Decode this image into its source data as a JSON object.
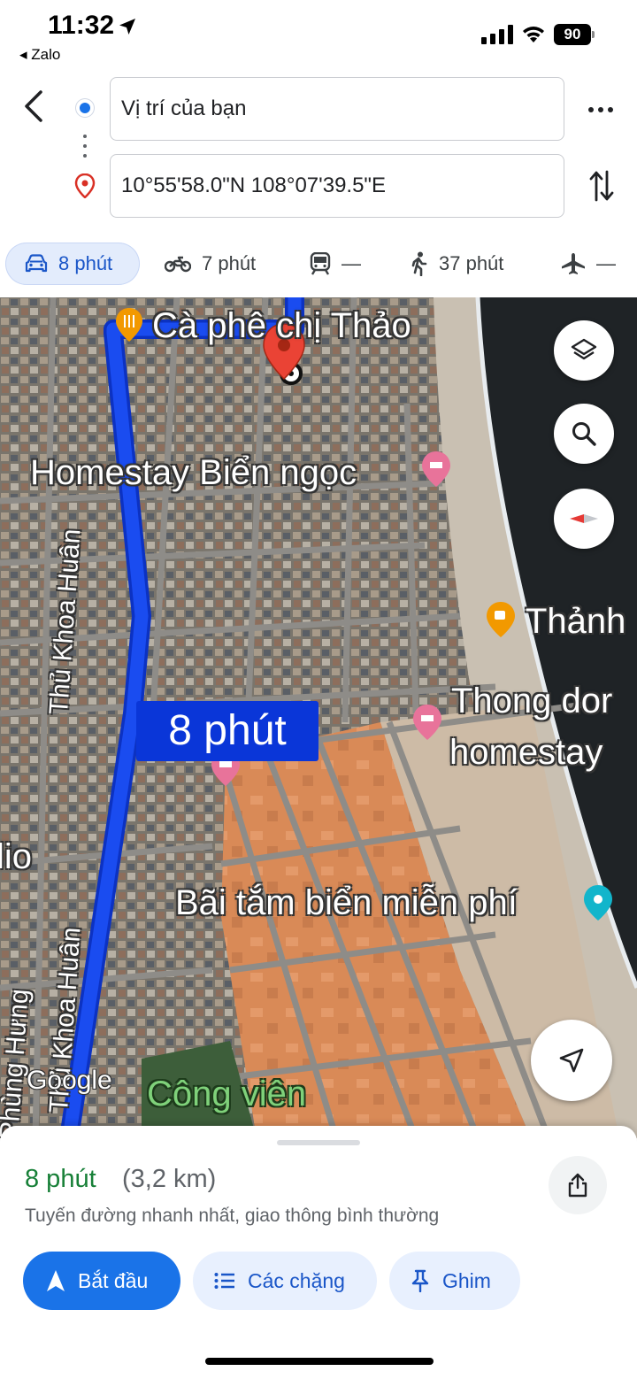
{
  "status_bar": {
    "time": "11:32",
    "back_app": "◂ Zalo",
    "battery": "90"
  },
  "route": {
    "origin": "Vị trí của bạn",
    "destination": "10°55'58.0\"N 108°07'39.5\"E"
  },
  "modes": [
    {
      "name": "drive",
      "label": "8 phút",
      "active": true
    },
    {
      "name": "motorbike",
      "label": "7 phút"
    },
    {
      "name": "transit",
      "label": "—"
    },
    {
      "name": "walk",
      "label": "37 phút"
    },
    {
      "name": "flight",
      "label": "—"
    }
  ],
  "map": {
    "labels": {
      "cafe": "Cà phê chị Thảo",
      "homestay_bien_ngoc": "Homestay Biển ngọc",
      "thanh": "Thảnh",
      "thong_dong_1": "Thong dor",
      "thong_dong_2": "homestay",
      "bai_tam": "Bãi tắm biển miễn phí",
      "cong_vien": "Công viên",
      "street_1": "Thủ Khoa Huân",
      "street_2": "Thủ Khoa Huân",
      "street_3": "Phùng Hưng",
      "left_edge": "lio"
    },
    "time_chip": "8 phút",
    "attribution": "Google"
  },
  "sheet": {
    "eta": "8 phút",
    "distance": "(3,2 km)",
    "description": "Tuyến đường nhanh nhất, giao thông bình thường",
    "start_label": "Bắt đầu",
    "stops_label": "Các chặng",
    "pin_label": "Ghim"
  },
  "colors": {
    "route_blue": "#1a4cf0",
    "accent": "#1a73e8",
    "eta_green": "#188038"
  }
}
